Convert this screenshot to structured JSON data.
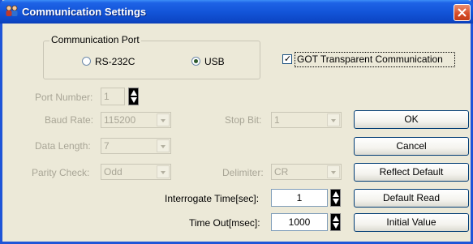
{
  "window": {
    "title": "Communication Settings",
    "close_glyph": "×"
  },
  "icons": {
    "app": "two-people-icon",
    "close": "close-icon"
  },
  "colors": {
    "titlebar": "#1355d9",
    "dialog_bg": "#ece9d8",
    "disabled_text": "#a8a596",
    "button_border": "#003c74"
  },
  "comm_port": {
    "title": "Communication Port",
    "options": [
      "RS-232C",
      "USB"
    ],
    "selected": "USB"
  },
  "got_transparent": {
    "label": "GOT Transparent Communication",
    "checked": true
  },
  "port_number": {
    "label": "Port Number:",
    "value": "1"
  },
  "baud_rate": {
    "label": "Baud Rate:",
    "value": "115200"
  },
  "data_length": {
    "label": "Data Length:",
    "value": "7"
  },
  "parity_check": {
    "label": "Parity Check:",
    "value": "Odd"
  },
  "stop_bit": {
    "label": "Stop Bit:",
    "value": "1"
  },
  "delimiter": {
    "label": "Delimiter:",
    "value": "CR"
  },
  "interrogate_time": {
    "label": "Interrogate Time[sec]:",
    "value": "1"
  },
  "time_out": {
    "label": "Time Out[msec]:",
    "value": "1000"
  },
  "buttons": {
    "ok": "OK",
    "cancel": "Cancel",
    "reflect_default": "Reflect Default",
    "default_read": "Default Read",
    "initial_value": "Initial Value"
  }
}
